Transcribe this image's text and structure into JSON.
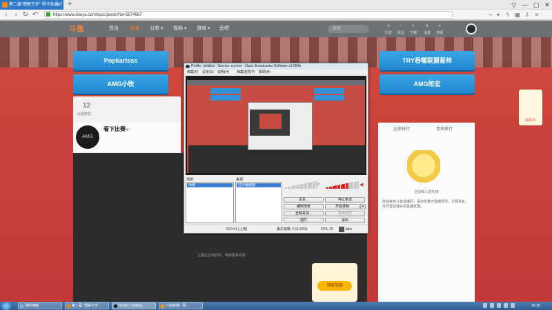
{
  "browser": {
    "tab_title": "第二届“理解万岁” 得卡色香计",
    "tab_close": "×",
    "new_tab": "+",
    "url": "https://www.douyu.com/topic/pwsb?rid=5574967",
    "window_controls": [
      "▽",
      "—",
      "▢",
      "✕"
    ],
    "nav_icons": [
      "back-icon",
      "forward-icon",
      "reload-icon",
      "undo-icon",
      "home-icon"
    ],
    "right_icons": [
      "share-icon",
      "dropdown-icon",
      "lightning-icon",
      "apps-icon",
      "download-icon",
      "menu-icon"
    ]
  },
  "site": {
    "logo": "斗鱼",
    "nav": [
      "首页",
      "直播",
      "分类 ▾",
      "视频 ▾",
      "游戏 ▾",
      "鱼吧"
    ],
    "active_nav": "直播",
    "search_placeholder": "搜索",
    "top_icons": [
      "历史",
      "关注",
      "下载",
      "消息",
      "开播"
    ]
  },
  "event_buttons": [
    "Popkartsss",
    "AMG小牧",
    "TRY吞噬联盟哥帅",
    "AMG皎宏"
  ],
  "room": {
    "count": "12",
    "count_label": "比赛排名",
    "anchor_name": "看下比赛~",
    "anchor_logo": "AMG",
    "video_tip": "主播正在休息中，稍候再来观看",
    "side_tabs": [
      "全部排行",
      "贵宾排行"
    ],
    "side_text": "欢迎来到斗鱼直播间，请自觉遵守直播规范，文明发言，共同营造良好的直播氛围。",
    "mascot_label": "还没有人送礼物",
    "gift_button": "领取奖励",
    "float_label": "抽奖中"
  },
  "obs": {
    "title": "Profile: Untitled - Scenes: scenes - Open Broadcaster Software v0.659b",
    "menu": [
      "档案(F)",
      "设定(S)",
      "说明(H)",
      "档案选项(P)",
      "帮助(H)"
    ],
    "scenes_label": "场景:",
    "sources_label": "来源:",
    "scene_selected": "场景",
    "source_selected": "显示器画面",
    "buttons_left": [
      "设定...",
      "编辑场景",
      "全域来源...",
      "插件"
    ],
    "buttons_right": [
      "停止串流",
      "开始录制",
      "停用预览",
      "退出"
    ],
    "status_time": "0:00:31  (上线)",
    "status_frames": "丢失帧数: 0 (0.00%)",
    "status_fps": "FPS: 29",
    "status_rate": "kb/s"
  },
  "taskbar": {
    "tasks": [
      "我的电脑",
      "第二届 “理解万岁”...",
      "Profile: Untitled...",
      "斗鱼直播 - 看..."
    ],
    "clock": "19:18"
  }
}
